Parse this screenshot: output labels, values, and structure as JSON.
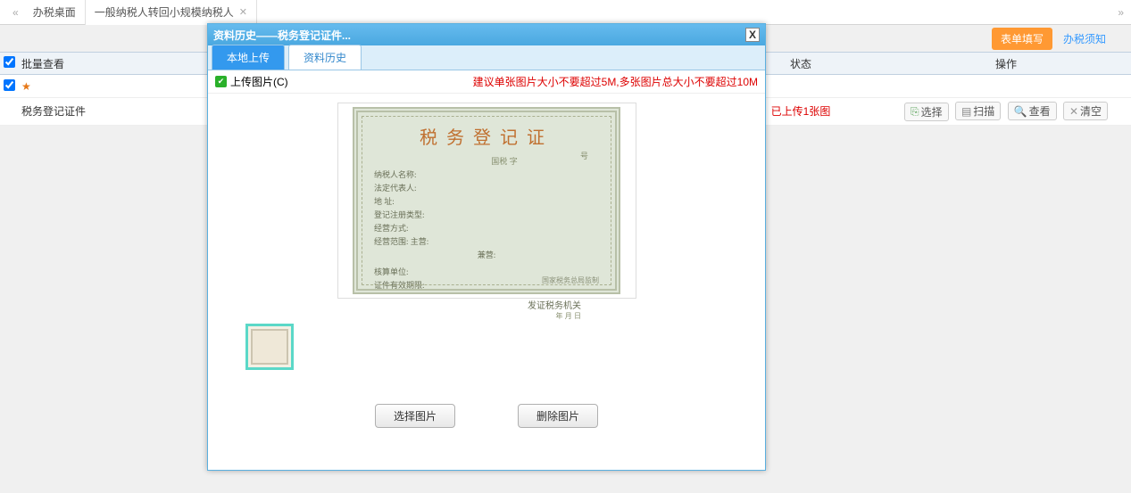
{
  "tabs": {
    "tab1": "办税桌面",
    "tab2": "一般纳税人转回小规模纳税人"
  },
  "actions": {
    "fill": "表单填写",
    "notice": "办税须知"
  },
  "list_header": {
    "batch_view": "批量查看",
    "status": "状态",
    "operation": "操作"
  },
  "row": {
    "name": "税务登记证件",
    "status": "已上传1张图",
    "btn_select": "选择",
    "btn_scan": "扫描",
    "btn_view": "查看",
    "btn_clear": "清空"
  },
  "dialog": {
    "title": "资料历史——税务登记证件...",
    "tab_local": "本地上传",
    "tab_history": "资料历史",
    "upload_label": "上传图片(C)",
    "hint": "建议单张图片大小不要超过5M,多张图片总大小不要超过10M",
    "btn_choose": "选择图片",
    "btn_delete": "删除图片"
  },
  "certificate": {
    "title": "税务登记证",
    "sub_left": "国税 字",
    "sub_right": "号",
    "r1": "纳税人名称:",
    "r2": "法定代表人:",
    "r3": "地      址:",
    "r4": "登记注册类型:",
    "r5": "经营方式:",
    "r6": "经营范围: 主营:",
    "mid": "兼营:",
    "r7": "核算单位:",
    "r8": "证件有效期限:",
    "sign": "发证税务机关",
    "date": "年  月  日",
    "footer": "国家税务总局监制"
  }
}
